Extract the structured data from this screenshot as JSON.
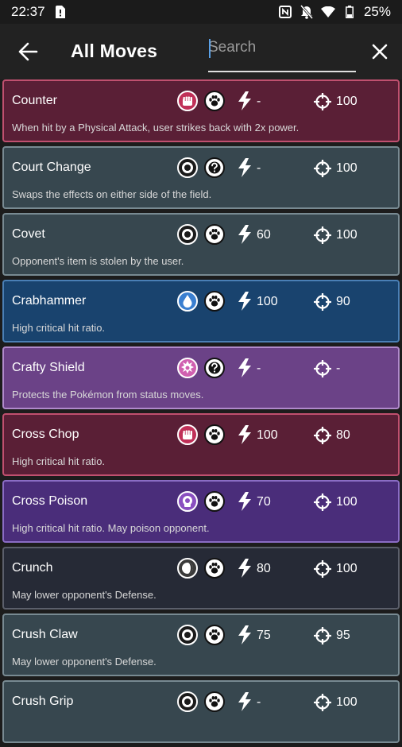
{
  "status": {
    "time": "22:37",
    "battery": "25%"
  },
  "appbar": {
    "title": "All Moves",
    "search_placeholder": "Search"
  },
  "moves": [
    {
      "name": "Counter",
      "desc": "When hit by a Physical Attack, user strikes back with 2x power.",
      "power": "-",
      "accuracy": "100",
      "type_icon": "fist-icon",
      "category_icon": "paw-icon",
      "bg": "#5a1f36",
      "border": "#c0506f"
    },
    {
      "name": "Court Change",
      "desc": "Swaps the effects on either side of the field.",
      "power": "-",
      "accuracy": "100",
      "type_icon": "normal-icon",
      "category_icon": "status-icon",
      "bg": "#37474f",
      "border": "#788a92"
    },
    {
      "name": "Covet",
      "desc": "Opponent's item is stolen by the user.",
      "power": "60",
      "accuracy": "100",
      "type_icon": "normal-icon",
      "category_icon": "paw-icon",
      "bg": "#37474f",
      "border": "#788a92"
    },
    {
      "name": "Crabhammer",
      "desc": "High critical hit ratio.",
      "power": "100",
      "accuracy": "90",
      "type_icon": "water-icon",
      "category_icon": "paw-icon",
      "bg": "#19436e",
      "border": "#4a7fb5"
    },
    {
      "name": "Crafty Shield",
      "desc": "Protects the Pokémon from status moves.",
      "power": "-",
      "accuracy": "-",
      "type_icon": "fairy-icon",
      "category_icon": "status-icon",
      "bg": "#6b4287",
      "border": "#b08acb"
    },
    {
      "name": "Cross Chop",
      "desc": "High critical hit ratio.",
      "power": "100",
      "accuracy": "80",
      "type_icon": "fist-icon",
      "category_icon": "paw-icon",
      "bg": "#5a1f36",
      "border": "#c0506f"
    },
    {
      "name": "Cross Poison",
      "desc": "High critical hit ratio. May poison opponent.",
      "power": "70",
      "accuracy": "100",
      "type_icon": "poison-icon",
      "category_icon": "paw-icon",
      "bg": "#4a2d7a",
      "border": "#8a6cc4"
    },
    {
      "name": "Crunch",
      "desc": "May lower opponent's Defense.",
      "power": "80",
      "accuracy": "100",
      "type_icon": "dark-icon",
      "category_icon": "paw-icon",
      "bg": "#262a36",
      "border": "#5b5f6b"
    },
    {
      "name": "Crush Claw",
      "desc": "May lower opponent's Defense.",
      "power": "75",
      "accuracy": "95",
      "type_icon": "normal-icon",
      "category_icon": "paw-icon",
      "bg": "#37474f",
      "border": "#788a92"
    },
    {
      "name": "Crush Grip",
      "desc": "",
      "power": "-",
      "accuracy": "100",
      "type_icon": "normal-icon",
      "category_icon": "paw-icon",
      "bg": "#37474f",
      "border": "#788a92"
    }
  ]
}
